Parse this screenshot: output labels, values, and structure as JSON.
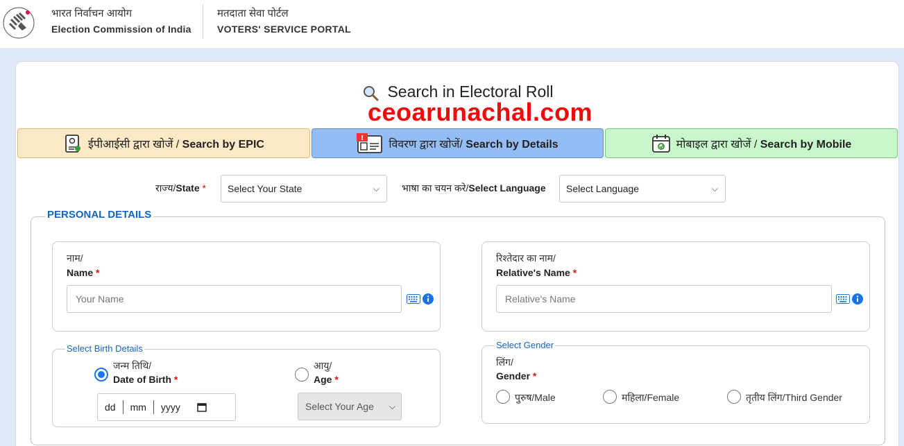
{
  "header": {
    "org_hindi": "भारत निर्वाचन आयोग",
    "org_english": "Election Commission of India",
    "portal_hindi": "मतदाता सेवा पोर्टल",
    "portal_english": "VOTERS' SERVICE PORTAL"
  },
  "page": {
    "title": "Search in Electoral Roll",
    "watermark": "ceoarunachal.com"
  },
  "tabs": [
    {
      "hindi": "ईपीआईसी द्वारा खोजें / ",
      "english": "Search by EPIC",
      "icon": "epic-card-icon"
    },
    {
      "hindi": "विवरण द्वारा खोजें/ ",
      "english": "Search by Details",
      "icon": "details-card-icon",
      "active": true
    },
    {
      "hindi": "मोबाइल द्वारा खोजें / ",
      "english": "Search by Mobile",
      "icon": "mobile-calendar-icon"
    }
  ],
  "state": {
    "label_hindi": "राज्य/",
    "label_english": "State",
    "required": "*",
    "selected": "Select Your State"
  },
  "language": {
    "label_hindi": "भाषा का चयन करे/",
    "label_english": "Select Language",
    "selected": "Select Language"
  },
  "personal_details": {
    "legend": "PERSONAL DETAILS",
    "name": {
      "label_hindi": "नाम/",
      "label_english": "Name",
      "required": "*",
      "placeholder": "Your Name"
    },
    "relative": {
      "label_hindi": "रिश्तेदार का नाम/",
      "label_english": "Relative's Name",
      "required": "*",
      "placeholder": "Relative's Name"
    },
    "birth": {
      "legend": "Select Birth Details",
      "dob_hindi": "जन्म तिथि/",
      "dob_english": "Date of Birth",
      "required": "*",
      "dd": "dd",
      "mm": "mm",
      "yyyy": "yyyy",
      "age_hindi": "आयु/",
      "age_english": "Age",
      "age_placeholder": "Select Your Age",
      "dob_selected": true
    },
    "gender": {
      "legend": "Select Gender",
      "label_hindi": "लिंग/",
      "label_english": "Gender",
      "required": "*",
      "options": [
        "पुरुष/Male",
        "महिला/Female",
        "तृतीय लिंग/Third Gender"
      ]
    }
  },
  "colors": {
    "accent_blue": "#1565c0",
    "watermark_red": "#ee0b0b",
    "tab_epic_bg": "#fde9c5",
    "tab_details_bg": "#95bdf5",
    "tab_mobile_bg": "#c8f7cb"
  }
}
